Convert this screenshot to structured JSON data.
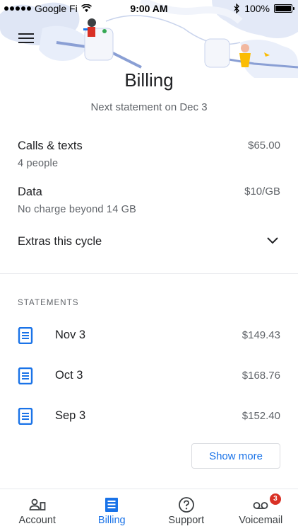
{
  "status_bar": {
    "carrier": "Google Fi",
    "time": "9:00 AM",
    "battery": "100%"
  },
  "header": {
    "title": "Billing",
    "next_statement": "Next statement on Dec 3"
  },
  "plan": {
    "calls": {
      "label": "Calls & texts",
      "sub": "4 people",
      "price": "$65.00"
    },
    "data": {
      "label": "Data",
      "sub": "No charge beyond 14 GB",
      "price": "$10/GB"
    },
    "extras": {
      "label": "Extras this cycle",
      "icon": "chevron-down-icon"
    }
  },
  "statements": {
    "section_label": "STATEMENTS",
    "items": [
      {
        "date": "Nov 3",
        "amount": "$149.43",
        "icon": "document-icon"
      },
      {
        "date": "Oct 3",
        "amount": "$168.76",
        "icon": "document-icon"
      },
      {
        "date": "Sep 3",
        "amount": "$152.40",
        "icon": "document-icon"
      }
    ],
    "show_more": "Show more"
  },
  "bottom_nav": {
    "items": [
      {
        "label": "Account",
        "icon": "account-icon",
        "active": false
      },
      {
        "label": "Billing",
        "icon": "billing-icon",
        "active": true
      },
      {
        "label": "Support",
        "icon": "help-icon",
        "active": false
      },
      {
        "label": "Voicemail",
        "icon": "voicemail-icon",
        "active": false,
        "badge": "3"
      }
    ]
  },
  "colors": {
    "accent": "#1a73e8",
    "badge": "#d93025",
    "text": "#202124",
    "secondary_text": "#5f6368"
  }
}
